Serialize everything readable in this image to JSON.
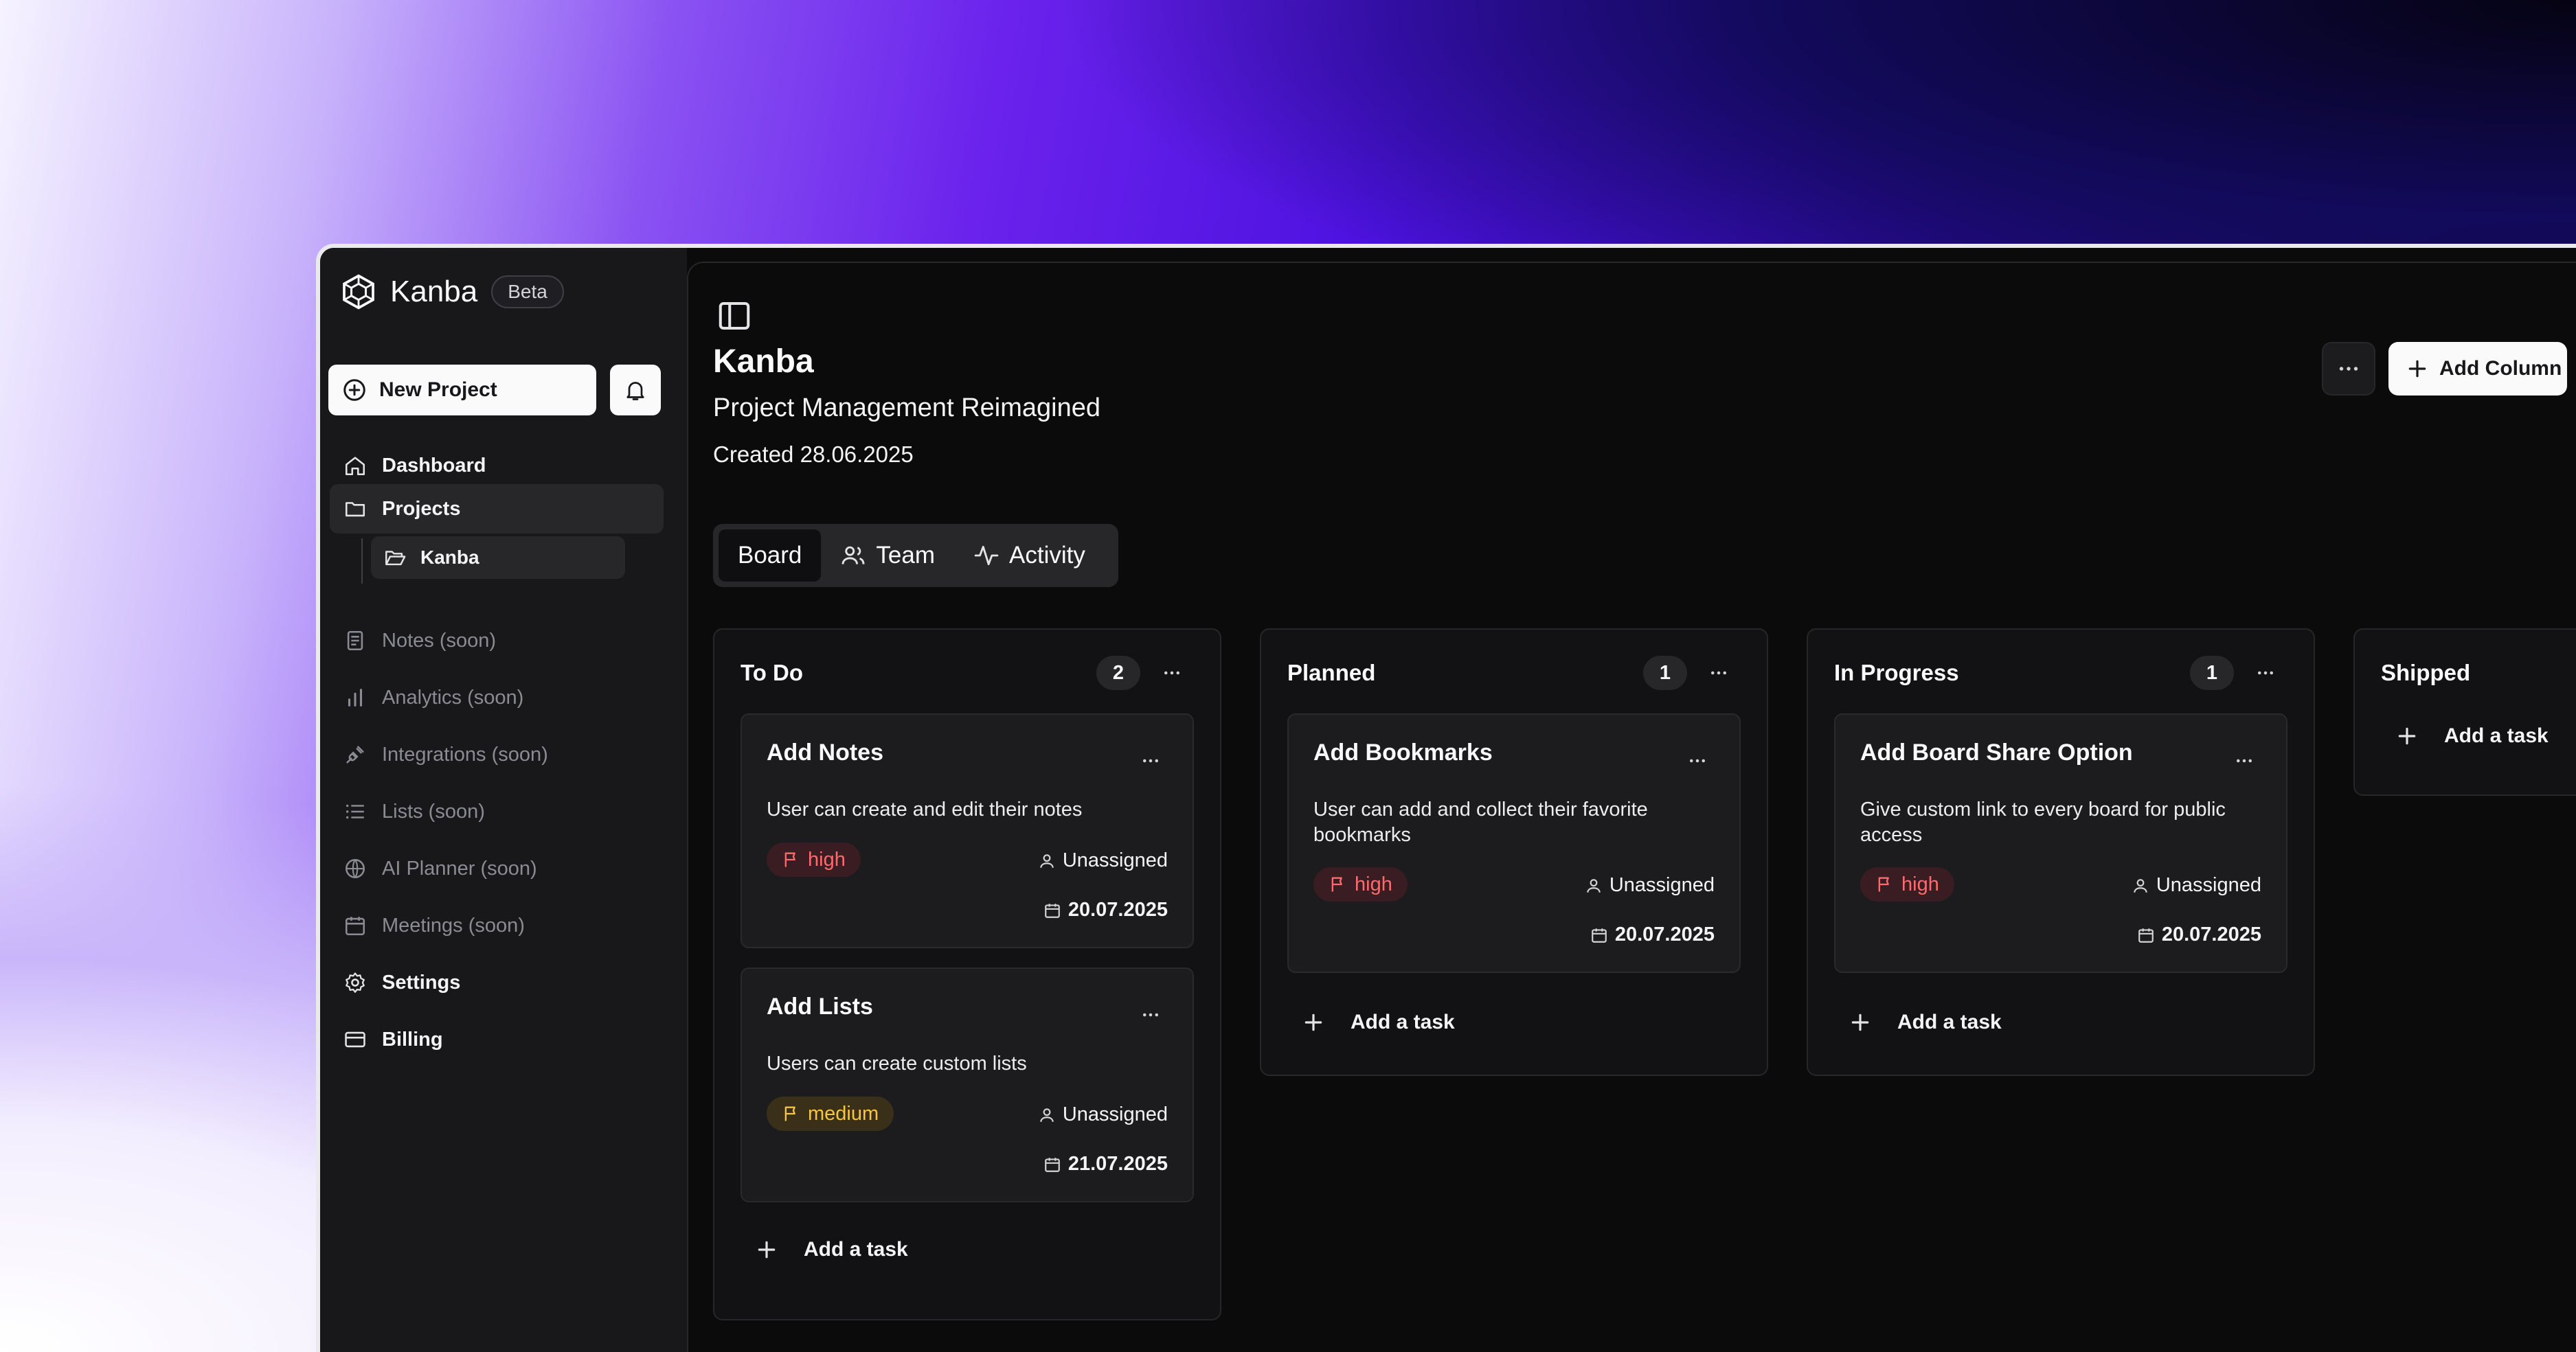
{
  "sidebar": {
    "app_name": "Kanba",
    "beta_label": "Beta",
    "new_project_label": "New Project",
    "nav": [
      {
        "label": "Dashboard",
        "icon": "home-icon"
      },
      {
        "label": "Projects",
        "icon": "folder-icon"
      },
      {
        "label": "Notes (soon)",
        "icon": "notes-icon"
      },
      {
        "label": "Analytics (soon)",
        "icon": "bar-chart-icon"
      },
      {
        "label": "Integrations (soon)",
        "icon": "plug-icon"
      },
      {
        "label": "Lists (soon)",
        "icon": "list-icon"
      },
      {
        "label": "AI Planner (soon)",
        "icon": "globe-icon"
      },
      {
        "label": "Meetings (soon)",
        "icon": "calendar-icon"
      },
      {
        "label": "Settings",
        "icon": "gear-icon"
      },
      {
        "label": "Billing",
        "icon": "credit-card-icon"
      }
    ],
    "sub_project": "Kanba"
  },
  "header": {
    "title": "Kanba",
    "subtitle": "Project Management Reimagined",
    "created": "Created 28.06.2025",
    "add_column_label": "Add Column"
  },
  "tabs": [
    "Board",
    "Team",
    "Activity"
  ],
  "columns": [
    {
      "title": "To Do",
      "count": "2",
      "cards": [
        {
          "title": "Add Notes",
          "description": "User can create and edit their notes",
          "priority": "high",
          "assignee": "Unassigned",
          "due": "20.07.2025"
        },
        {
          "title": "Add Lists",
          "description": "Users can create custom lists",
          "priority": "medium",
          "assignee": "Unassigned",
          "due": "21.07.2025"
        }
      ],
      "add_task_label": "Add a task"
    },
    {
      "title": "Planned",
      "count": "1",
      "cards": [
        {
          "title": "Add Bookmarks",
          "description": "User can add and collect their favorite bookmarks",
          "priority": "high",
          "assignee": "Unassigned",
          "due": "20.07.2025"
        }
      ],
      "add_task_label": "Add a task"
    },
    {
      "title": "In Progress",
      "count": "1",
      "cards": [
        {
          "title": "Add Board Share Option",
          "description": "Give custom link to every board for public access",
          "priority": "high",
          "assignee": "Unassigned",
          "due": "20.07.2025"
        }
      ],
      "add_task_label": "Add a task"
    },
    {
      "title": "Shipped",
      "cards": [],
      "add_task_label": "Add a task"
    }
  ],
  "colors": {
    "priority_high": "#ff6b6b",
    "priority_medium": "#f5c542",
    "surface": "#121214",
    "accent_bg": "#fafafa"
  }
}
